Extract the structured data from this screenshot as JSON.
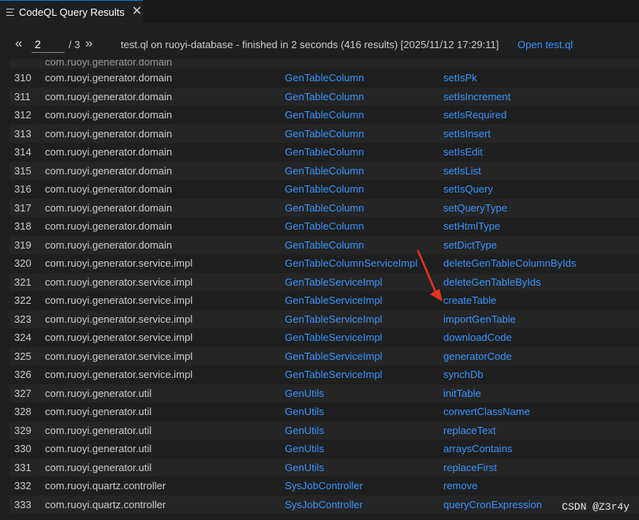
{
  "tab": {
    "title": "CodeQL Query Results",
    "close_glyph": "✕"
  },
  "toolbar": {
    "prev_glyph": "«",
    "next_glyph": "»",
    "page_value": "2",
    "page_total": "/ 3",
    "status": "test.ql on ruoyi-database - finished in 2 seconds (416 results) [2025/11/12 17:29:11]",
    "open_link": "Open test.ql"
  },
  "partial_row_text": "com.ruoyi.generator.domain",
  "rows": [
    {
      "num": "310",
      "pkg": "com.ruoyi.generator.domain",
      "cls": "GenTableColumn",
      "method": "setIsPk"
    },
    {
      "num": "311",
      "pkg": "com.ruoyi.generator.domain",
      "cls": "GenTableColumn",
      "method": "setIsIncrement"
    },
    {
      "num": "312",
      "pkg": "com.ruoyi.generator.domain",
      "cls": "GenTableColumn",
      "method": "setIsRequired"
    },
    {
      "num": "313",
      "pkg": "com.ruoyi.generator.domain",
      "cls": "GenTableColumn",
      "method": "setIsInsert"
    },
    {
      "num": "314",
      "pkg": "com.ruoyi.generator.domain",
      "cls": "GenTableColumn",
      "method": "setIsEdit"
    },
    {
      "num": "315",
      "pkg": "com.ruoyi.generator.domain",
      "cls": "GenTableColumn",
      "method": "setIsList"
    },
    {
      "num": "316",
      "pkg": "com.ruoyi.generator.domain",
      "cls": "GenTableColumn",
      "method": "setIsQuery"
    },
    {
      "num": "317",
      "pkg": "com.ruoyi.generator.domain",
      "cls": "GenTableColumn",
      "method": "setQueryType"
    },
    {
      "num": "318",
      "pkg": "com.ruoyi.generator.domain",
      "cls": "GenTableColumn",
      "method": "setHtmlType"
    },
    {
      "num": "319",
      "pkg": "com.ruoyi.generator.domain",
      "cls": "GenTableColumn",
      "method": "setDictType"
    },
    {
      "num": "320",
      "pkg": "com.ruoyi.generator.service.impl",
      "cls": "GenTableColumnServiceImpl",
      "method": "deleteGenTableColumnByIds"
    },
    {
      "num": "321",
      "pkg": "com.ruoyi.generator.service.impl",
      "cls": "GenTableServiceImpl",
      "method": "deleteGenTableByIds"
    },
    {
      "num": "322",
      "pkg": "com.ruoyi.generator.service.impl",
      "cls": "GenTableServiceImpl",
      "method": "createTable"
    },
    {
      "num": "323",
      "pkg": "com.ruoyi.generator.service.impl",
      "cls": "GenTableServiceImpl",
      "method": "importGenTable"
    },
    {
      "num": "324",
      "pkg": "com.ruoyi.generator.service.impl",
      "cls": "GenTableServiceImpl",
      "method": "downloadCode"
    },
    {
      "num": "325",
      "pkg": "com.ruoyi.generator.service.impl",
      "cls": "GenTableServiceImpl",
      "method": "generatorCode"
    },
    {
      "num": "326",
      "pkg": "com.ruoyi.generator.service.impl",
      "cls": "GenTableServiceImpl",
      "method": "synchDb"
    },
    {
      "num": "327",
      "pkg": "com.ruoyi.generator.util",
      "cls": "GenUtils",
      "method": "initTable"
    },
    {
      "num": "328",
      "pkg": "com.ruoyi.generator.util",
      "cls": "GenUtils",
      "method": "convertClassName"
    },
    {
      "num": "329",
      "pkg": "com.ruoyi.generator.util",
      "cls": "GenUtils",
      "method": "replaceText"
    },
    {
      "num": "330",
      "pkg": "com.ruoyi.generator.util",
      "cls": "GenUtils",
      "method": "arraysContains"
    },
    {
      "num": "331",
      "pkg": "com.ruoyi.generator.util",
      "cls": "GenUtils",
      "method": "replaceFirst"
    },
    {
      "num": "332",
      "pkg": "com.ruoyi.quartz.controller",
      "cls": "SysJobController",
      "method": "remove"
    },
    {
      "num": "333",
      "pkg": "com.ruoyi.quartz.controller",
      "cls": "SysJobController",
      "method": "queryCronExpression"
    }
  ],
  "annotation": {
    "arrow_color": "#e8321e"
  },
  "watermark": "CSDN @Z3r4y",
  "colors": {
    "background": "#1f1f1f",
    "link": "#3794ff",
    "row_alt": "#252526",
    "text": "#cccccc"
  }
}
